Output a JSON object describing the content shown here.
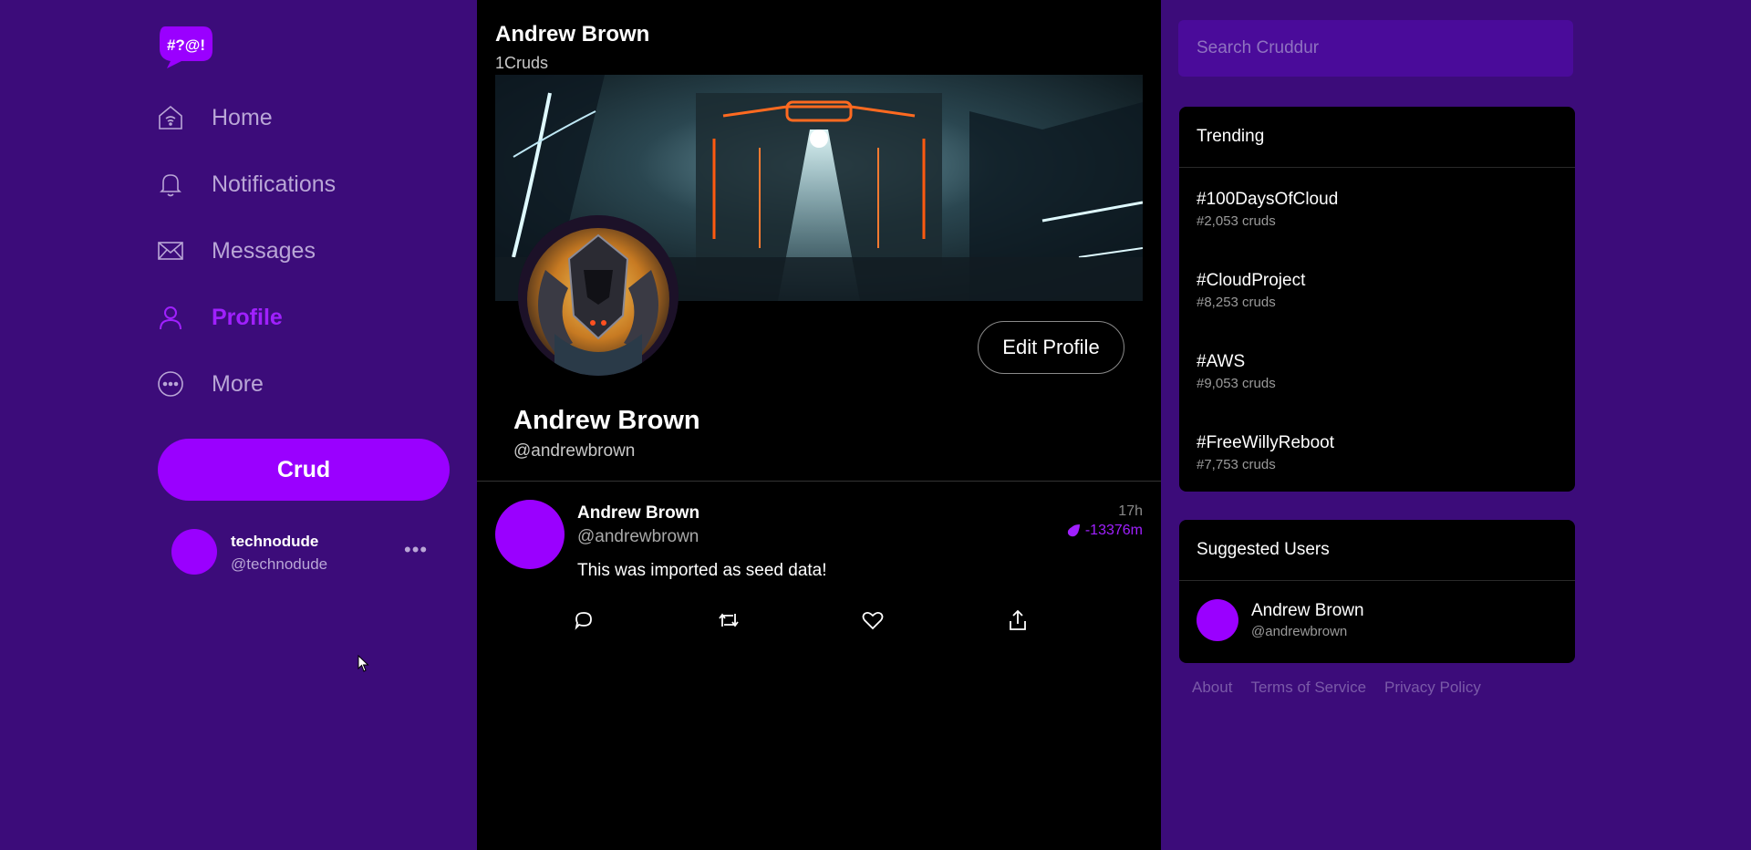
{
  "sidebar": {
    "logo_text": "#?@!",
    "nav": [
      {
        "label": "Home",
        "icon": "home-icon"
      },
      {
        "label": "Notifications",
        "icon": "bell-icon"
      },
      {
        "label": "Messages",
        "icon": "envelope-icon"
      },
      {
        "label": "Profile",
        "icon": "user-icon",
        "active": true
      },
      {
        "label": "More",
        "icon": "more-circle-icon"
      }
    ],
    "crud_button": "Crud",
    "user": {
      "name": "technodude",
      "handle": "@technodude",
      "menu": "•••"
    }
  },
  "profile": {
    "header_name": "Andrew Brown",
    "header_count": "1Cruds",
    "edit_button": "Edit Profile",
    "display_name": "Andrew Brown",
    "handle": "@andrewbrown"
  },
  "feed": [
    {
      "name": "Andrew Brown",
      "handle": "@andrewbrown",
      "time": "17h",
      "expires": "-13376m",
      "message": "This was imported as seed data!"
    }
  ],
  "right": {
    "search_placeholder": "Search Cruddur",
    "trending_title": "Trending",
    "trending": [
      {
        "tag": "#100DaysOfCloud",
        "count": "#2,053 cruds"
      },
      {
        "tag": "#CloudProject",
        "count": "#8,253 cruds"
      },
      {
        "tag": "#AWS",
        "count": "#9,053 cruds"
      },
      {
        "tag": "#FreeWillyReboot",
        "count": "#7,753 cruds"
      }
    ],
    "suggested_title": "Suggested Users",
    "suggested": [
      {
        "name": "Andrew Brown",
        "handle": "@andrewbrown"
      }
    ],
    "footer": [
      "About",
      "Terms of Service",
      "Privacy Policy"
    ]
  },
  "colors": {
    "background": "#3c0c7a",
    "accent": "#9a00ff",
    "panel": "#000000"
  }
}
